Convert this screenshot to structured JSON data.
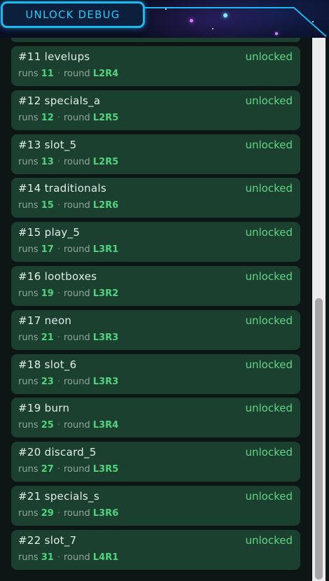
{
  "header": {
    "tab_label": "UNLOCK DEBUG"
  },
  "colors": {
    "accent": "#1fb7f0",
    "card_bg": "#1b4030",
    "status_unlocked": "#62d485",
    "value_green": "#52d37d"
  },
  "items": [
    {
      "title": "#11 levelups",
      "status": "unlocked",
      "runs_label": "runs",
      "runs": "11",
      "sep": "·",
      "round_label": "round",
      "round": "L2R4"
    },
    {
      "title": "#12 specials_a",
      "status": "unlocked",
      "runs_label": "runs",
      "runs": "12",
      "sep": "·",
      "round_label": "round",
      "round": "L2R5"
    },
    {
      "title": "#13 slot_5",
      "status": "unlocked",
      "runs_label": "runs",
      "runs": "13",
      "sep": "·",
      "round_label": "round",
      "round": "L2R5"
    },
    {
      "title": "#14 traditionals",
      "status": "unlocked",
      "runs_label": "runs",
      "runs": "15",
      "sep": "·",
      "round_label": "round",
      "round": "L2R6"
    },
    {
      "title": "#15 play_5",
      "status": "unlocked",
      "runs_label": "runs",
      "runs": "17",
      "sep": "·",
      "round_label": "round",
      "round": "L3R1"
    },
    {
      "title": "#16 lootboxes",
      "status": "unlocked",
      "runs_label": "runs",
      "runs": "19",
      "sep": "·",
      "round_label": "round",
      "round": "L3R2"
    },
    {
      "title": "#17 neon",
      "status": "unlocked",
      "runs_label": "runs",
      "runs": "21",
      "sep": "·",
      "round_label": "round",
      "round": "L3R3"
    },
    {
      "title": "#18 slot_6",
      "status": "unlocked",
      "runs_label": "runs",
      "runs": "23",
      "sep": "·",
      "round_label": "round",
      "round": "L3R3"
    },
    {
      "title": "#19 burn",
      "status": "unlocked",
      "runs_label": "runs",
      "runs": "25",
      "sep": "·",
      "round_label": "round",
      "round": "L3R4"
    },
    {
      "title": "#20 discard_5",
      "status": "unlocked",
      "runs_label": "runs",
      "runs": "27",
      "sep": "·",
      "round_label": "round",
      "round": "L3R5"
    },
    {
      "title": "#21 specials_s",
      "status": "unlocked",
      "runs_label": "runs",
      "runs": "29",
      "sep": "·",
      "round_label": "round",
      "round": "L3R6"
    },
    {
      "title": "#22 slot_7",
      "status": "unlocked",
      "runs_label": "runs",
      "runs": "31",
      "sep": "·",
      "round_label": "round",
      "round": "L4R1"
    }
  ]
}
